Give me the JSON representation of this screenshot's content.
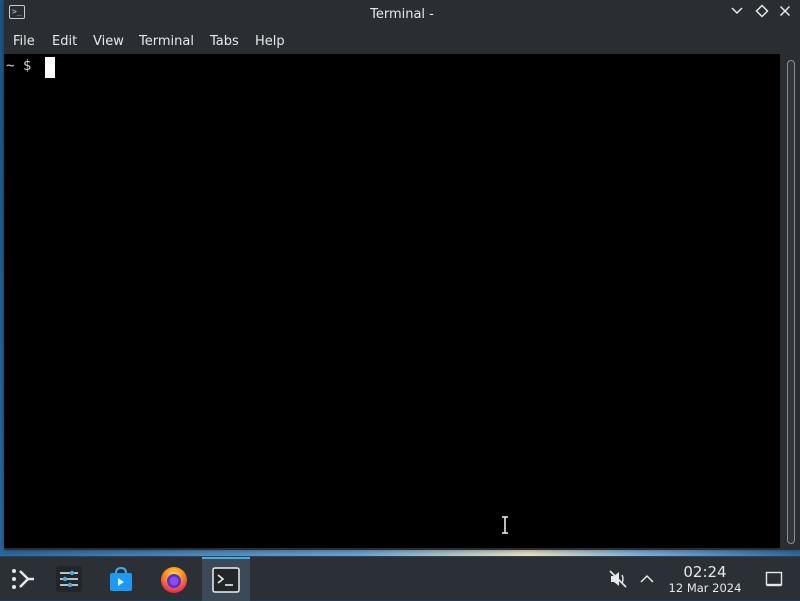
{
  "window": {
    "title": "Terminal -",
    "controls": [
      "chevron-down-icon",
      "diamond-icon",
      "close-icon"
    ]
  },
  "menu": {
    "items": [
      "File",
      "Edit",
      "View",
      "Terminal",
      "Tabs",
      "Help"
    ]
  },
  "terminal": {
    "prompt": "~ $",
    "background": "#000000",
    "foreground": "#d0d0d0"
  },
  "taskbar": {
    "apps": [
      "application-launcher-icon",
      "system-settings-icon",
      "discover-store-icon",
      "firefox-icon",
      "terminal-icon"
    ],
    "active_app": "terminal-icon",
    "tray": [
      "volume-muted-icon",
      "chevron-up-icon"
    ],
    "clock": {
      "time": "02:24",
      "date": "12 Mar 2024"
    },
    "accent": "#3daee9"
  }
}
